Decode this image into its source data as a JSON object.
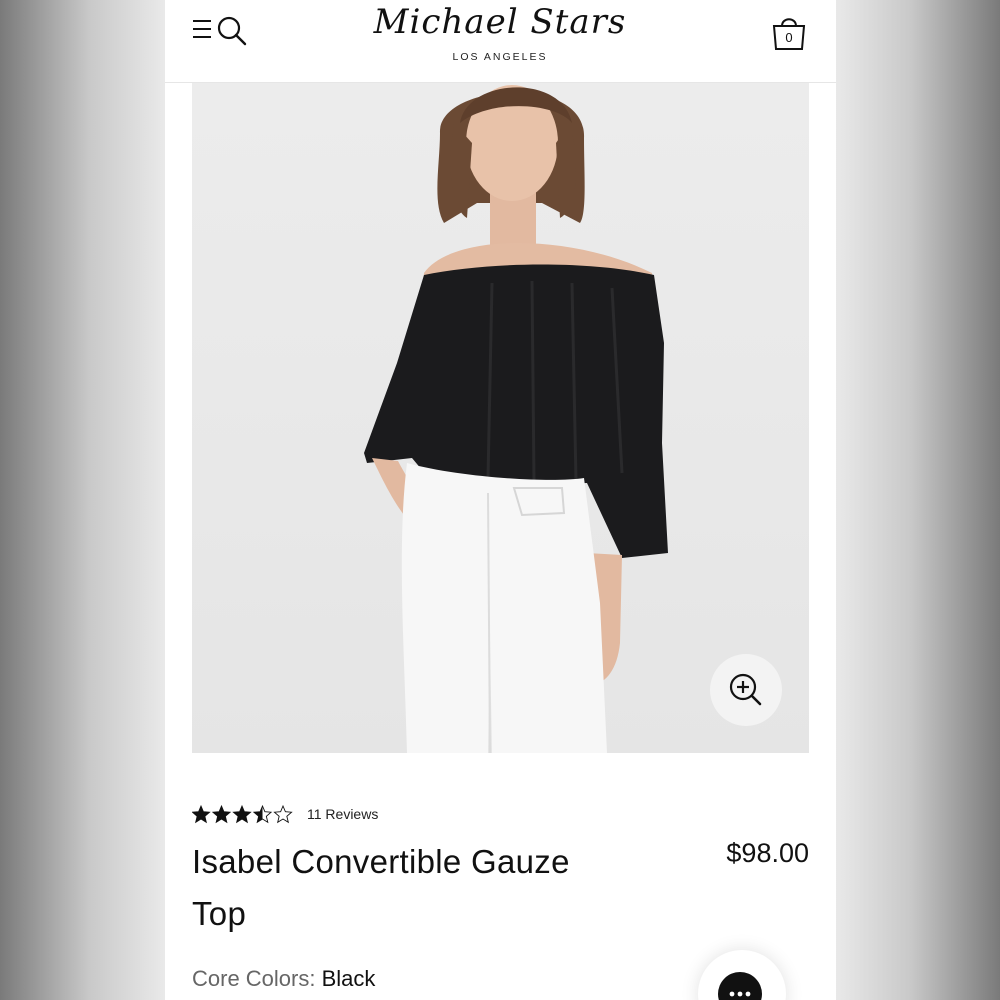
{
  "header": {
    "brand_name": "Michael Stars",
    "brand_subtitle": "LOS ANGELES",
    "bag_count": "0",
    "icons": [
      "menu-icon",
      "search-icon",
      "shopping-bag-icon"
    ]
  },
  "product": {
    "image_alt": "Model wearing black off-the-shoulder gauze top with white jeans",
    "rating": 3.5,
    "rating_max": 5,
    "reviews_label": "11 Reviews",
    "title": "Isabel Convertible Gauze Top",
    "price": "$98.00",
    "color_label": "Core Colors:",
    "color_value": "Black"
  },
  "colors": {
    "text": "#111111",
    "muted": "#666666",
    "image_bg": "#e9e9e9",
    "accent": "#111111"
  }
}
